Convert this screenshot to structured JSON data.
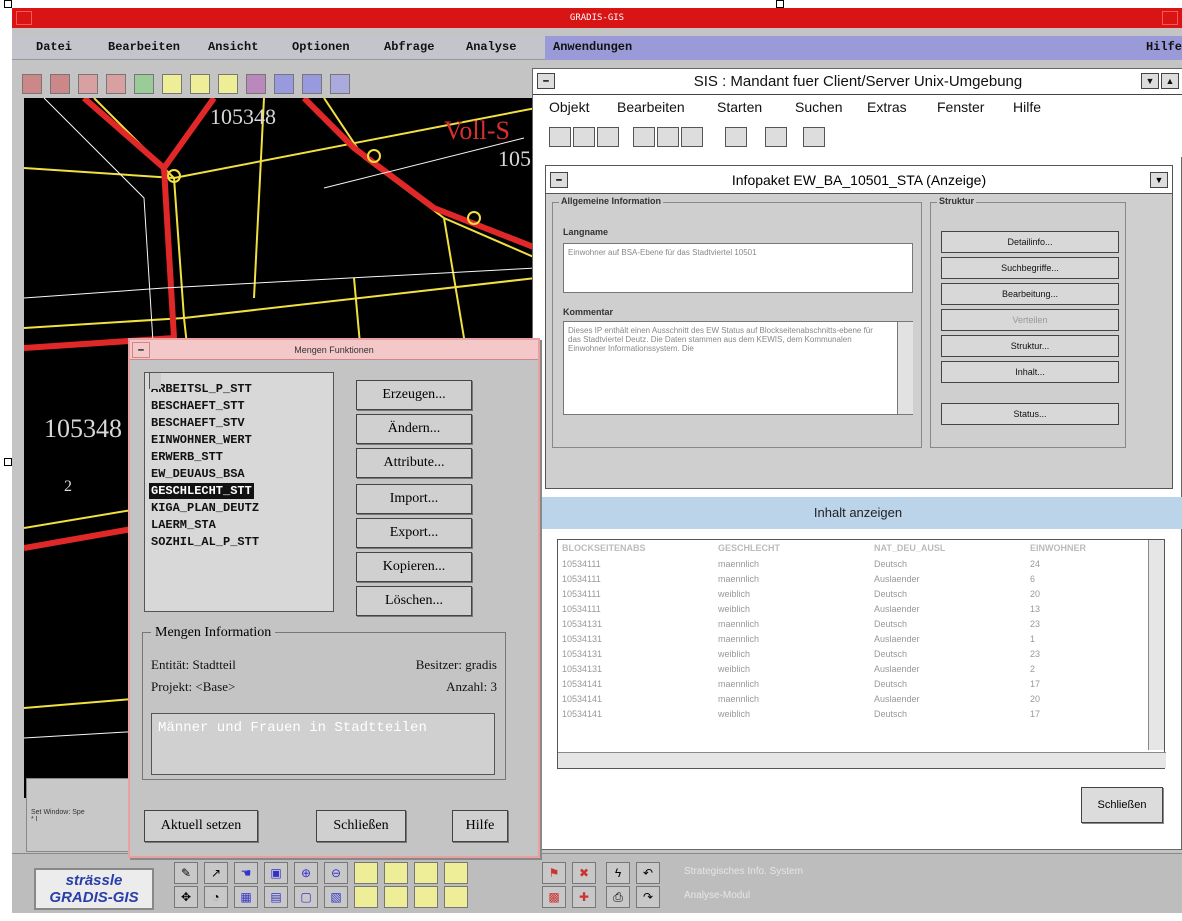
{
  "app": {
    "title": "GRADIS-GIS"
  },
  "menu": [
    "Datei",
    "Bearbeiten",
    "Ansicht",
    "Optionen",
    "Abfrage",
    "Analyse",
    "Anwendungen",
    "Hilfe"
  ],
  "map": {
    "labels": [
      "105348",
      "105348",
      "Voll-S",
      "105",
      "2"
    ]
  },
  "status": {
    "line1": "Set Window: Spe",
    "line2": "* I"
  },
  "logo": {
    "line1": "strässle",
    "line2": "GRADIS-GIS"
  },
  "bottom": {
    "system_text": "Strategisches Info. System",
    "module_text": "Analyse-Modul"
  },
  "sis": {
    "title": "SIS : Mandant fuer Client/Server Unix-Umgebung",
    "menu": [
      "Objekt",
      "Bearbeiten",
      "Starten",
      "Suchen",
      "Extras",
      "Fenster",
      "Hilfe"
    ],
    "infopaket": {
      "title": "Infopaket EW_BA_10501_STA (Anzeige)",
      "allgemeine_legend": "Allgemeine Information",
      "langname_label": "Langname",
      "langname_value": "Einwohner auf BSA-Ebene für das Stadtviertel 10501",
      "kommentar_label": "Kommentar",
      "kommentar_value": "Dieses IP enthält einen Ausschnitt des EW Status auf Blockseitenabschnitts-ebene für das Stadtviertel Deutz. Die Daten stammen aus dem KEWIS, dem Kommunalen Einwohner Informationssystem. Die",
      "struktur_legend": "Struktur",
      "struktur_buttons": [
        "Detailinfo...",
        "Suchbegriffe...",
        "Bearbeitung...",
        "Verteilen",
        "Struktur...",
        "Inhalt...",
        "Status..."
      ]
    },
    "inhalt_title": "Inhalt anzeigen",
    "table": {
      "columns": [
        "BLOCKSEITENABS",
        "GESCHLECHT",
        "NAT_DEU_AUSL",
        "EINWOHNER"
      ],
      "rows": [
        [
          "10534111",
          "maennlich",
          "Deutsch",
          "24"
        ],
        [
          "10534111",
          "maennlich",
          "Auslaender",
          "6"
        ],
        [
          "10534111",
          "weiblich",
          "Deutsch",
          "20"
        ],
        [
          "10534111",
          "weiblich",
          "Auslaender",
          "13"
        ],
        [
          "10534131",
          "maennlich",
          "Deutsch",
          "23"
        ],
        [
          "10534131",
          "maennlich",
          "Auslaender",
          "1"
        ],
        [
          "10534131",
          "weiblich",
          "Deutsch",
          "23"
        ],
        [
          "10534131",
          "weiblich",
          "Auslaender",
          "2"
        ],
        [
          "10534141",
          "maennlich",
          "Deutsch",
          "17"
        ],
        [
          "10534141",
          "maennlich",
          "Auslaender",
          "20"
        ],
        [
          "10534141",
          "weiblich",
          "Deutsch",
          "17"
        ]
      ]
    },
    "close_label": "Schließen"
  },
  "mengen": {
    "title": "Mengen Funktionen",
    "items": [
      "ARBEITSL_P_STT",
      "BESCHAEFT_STT",
      "BESCHAEFT_STV",
      "EINWOHNER_WERT",
      "ERWERB_STT",
      "EW_DEUAUS_BSA",
      "GESCHLECHT_STT",
      "KIGA_PLAN_DEUTZ",
      "LAERM_STA",
      "SOZHIL_AL_P_STT"
    ],
    "selected_index": 6,
    "buttons": [
      "Erzeugen...",
      "Ändern...",
      "Attribute...",
      "Import...",
      "Export...",
      "Kopieren...",
      "Löschen..."
    ],
    "info_legend": "Mengen Information",
    "entitaet": "Entität: Stadtteil",
    "besitzer": "Besitzer: gradis",
    "projekt": "Projekt: <Base>",
    "anzahl": "Anzahl: 3",
    "description": "Männer und Frauen in Stadtteilen",
    "footer": {
      "aktuell": "Aktuell setzen",
      "schliessen": "Schließen",
      "hilfe": "Hilfe"
    }
  }
}
